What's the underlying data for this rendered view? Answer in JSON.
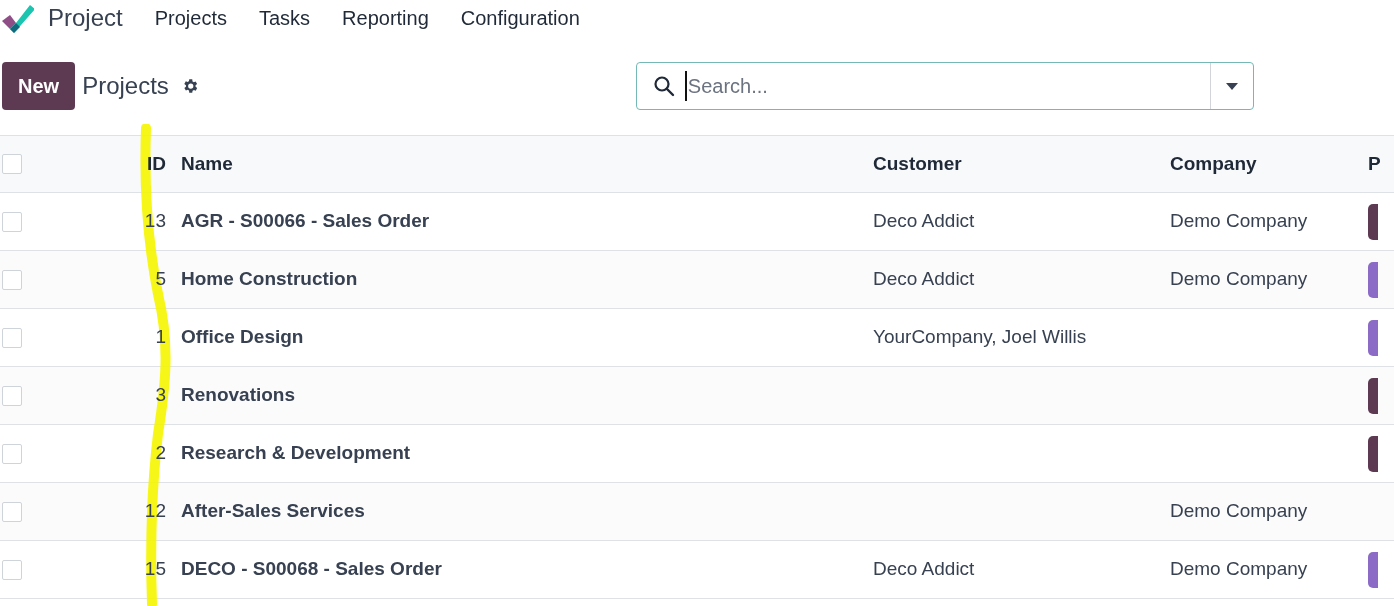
{
  "app": {
    "title": "Project"
  },
  "menu": [
    "Projects",
    "Tasks",
    "Reporting",
    "Configuration"
  ],
  "toolbar": {
    "new_button": "New",
    "breadcrumb": "Projects"
  },
  "search": {
    "placeholder": "Search..."
  },
  "table": {
    "all_selected": false,
    "columns": [
      "ID",
      "Name",
      "Customer",
      "Company",
      "P"
    ],
    "rows": [
      {
        "selected": false,
        "id": "13",
        "name": "AGR - S00066 - Sales Order",
        "customer": "Deco Addict",
        "company": "Demo Company",
        "color": "#5e3a52"
      },
      {
        "selected": false,
        "id": "5",
        "name": "Home Construction",
        "customer": "Deco Addict",
        "company": "Demo Company",
        "color": "#8b6bc6"
      },
      {
        "selected": false,
        "id": "1",
        "name": "Office Design",
        "customer": "YourCompany, Joel Willis",
        "color": "#8b6bc6"
      },
      {
        "selected": false,
        "id": "3",
        "name": "Renovations",
        "color": "#5e3a52"
      },
      {
        "selected": false,
        "id": "2",
        "name": "Research & Development",
        "color": "#5e3a52"
      },
      {
        "selected": false,
        "id": "12",
        "name": "After-Sales Services",
        "company": "Demo Company"
      },
      {
        "selected": false,
        "id": "15",
        "name": "DECO - S00068 - Sales Order",
        "customer": "Deco Addict",
        "company": "Demo Company",
        "color": "#8b6bc6"
      }
    ]
  }
}
